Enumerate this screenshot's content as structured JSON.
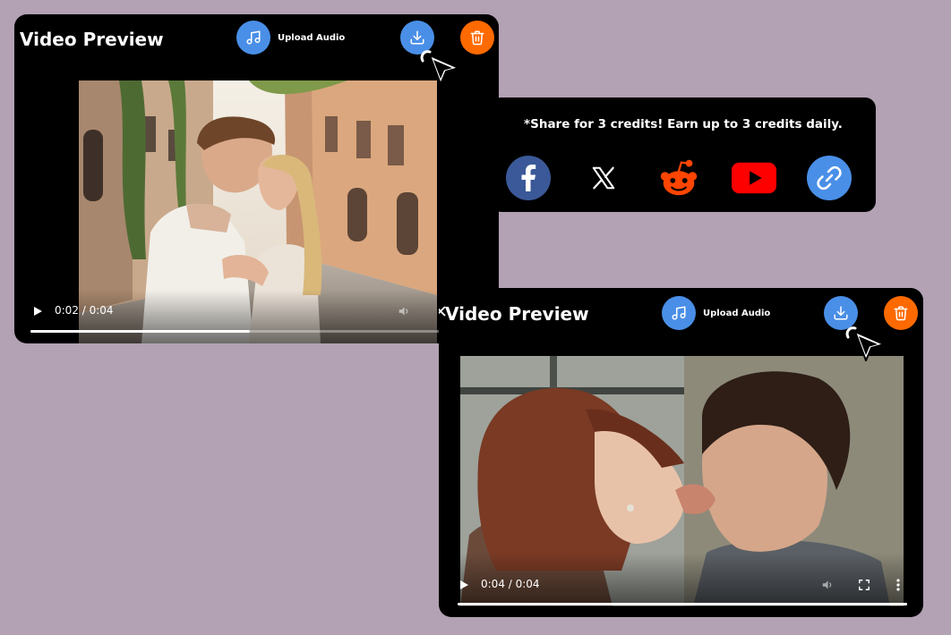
{
  "preview_top": {
    "title": "Video Preview",
    "upload_label": "Upload Audio",
    "time": "0:02 / 0:04",
    "progress": 0.5
  },
  "preview_bottom": {
    "title": "Video Preview",
    "upload_label": "Upload Audio",
    "time": "0:04 / 0:04",
    "progress": 1.0
  },
  "share": {
    "message": "*Share for 3 credits! Earn up to 3 credits daily.",
    "options": [
      "facebook-icon",
      "x-icon",
      "reddit-icon",
      "youtube-icon",
      "link-icon"
    ]
  },
  "colors": {
    "background": "#b3a1b4",
    "accent_blue": "#4a8fe7",
    "delete_orange": "#ff6a00",
    "facebook": "#3b5998",
    "reddit": "#ff4500",
    "youtube": "#ff0000"
  }
}
